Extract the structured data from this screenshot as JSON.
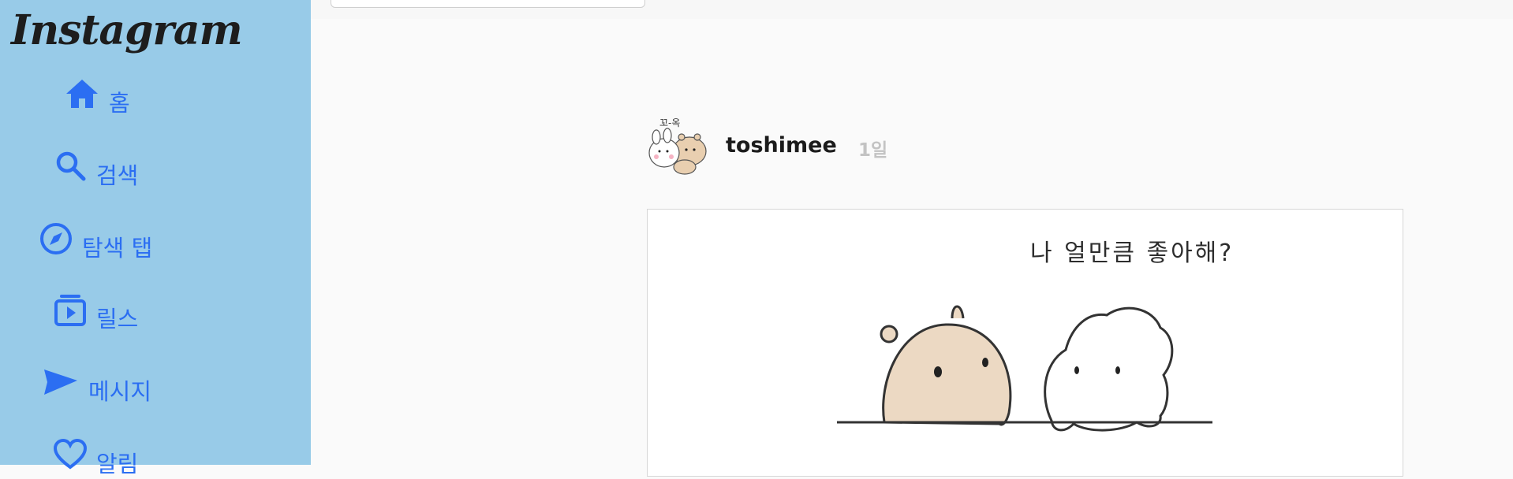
{
  "app": {
    "logo_text": "Instagram"
  },
  "sidebar": {
    "items": [
      {
        "label": "홈",
        "icon": "home-icon"
      },
      {
        "label": "검색",
        "icon": "search-icon"
      },
      {
        "label": "탐색 탭",
        "icon": "compass-icon"
      },
      {
        "label": "릴스",
        "icon": "reels-icon"
      },
      {
        "label": "메시지",
        "icon": "send-icon"
      },
      {
        "label": "알림",
        "icon": "heart-icon"
      }
    ]
  },
  "post": {
    "username": "toshimee",
    "time": "1일",
    "avatar_caption": "꼬-옥",
    "image_caption": "나 얼만큼 좋아해?"
  },
  "colors": {
    "sidebar_bg": "#98cbe8",
    "accent": "#2b6ef2",
    "page_bg": "#fafafa"
  }
}
